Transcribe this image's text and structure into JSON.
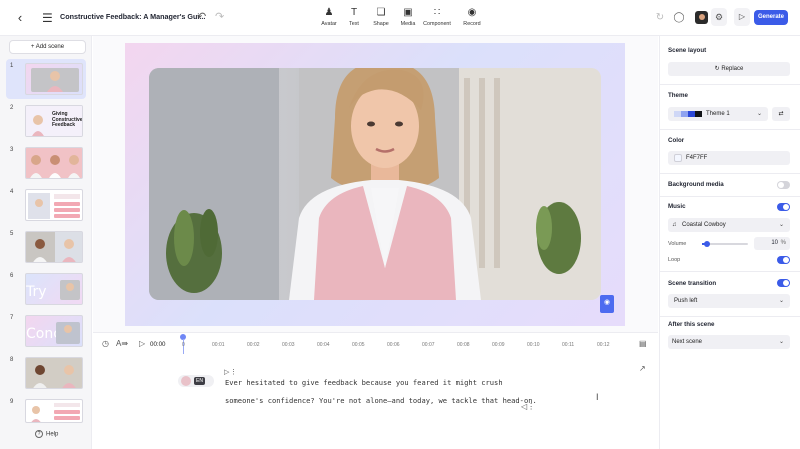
{
  "header": {
    "title": "Constructive Feedback: A Manager's Gui...",
    "tools": [
      "Avatar",
      "Text",
      "Shape",
      "Media",
      "Component",
      "Record"
    ],
    "generate_label": "Generate"
  },
  "sidebar": {
    "add_scene_label": "Add scene",
    "scenes": [
      "1",
      "2",
      "3",
      "4",
      "5",
      "6",
      "7",
      "8",
      "9"
    ],
    "scene2_thumb_text": "Giving Constructive Feedback",
    "help_label": "Help"
  },
  "timeline": {
    "current_time": "00:00",
    "ticks": [
      "0",
      "00:01",
      "00:02",
      "00:03",
      "00:04",
      "00:05",
      "00:06",
      "00:07",
      "00:08",
      "00:09",
      "00:10",
      "00:11",
      "00:12"
    ]
  },
  "script": {
    "language": "EN",
    "line1": "Ever hesitated to give feedback because you feared it might crush",
    "line2": "someone's confidence? You're not alone—and today, we tackle that head-on."
  },
  "right_panel": {
    "scene_layout_label": "Scene layout",
    "replace_label": "Replace",
    "theme_label": "Theme",
    "theme_value": "Theme 1",
    "theme_swatches": [
      "#cfd7f6",
      "#8fa3f0",
      "#2b48d8",
      "#111418"
    ],
    "color_label": "Color",
    "color_value": "F4F7FF",
    "background_media_label": "Background media",
    "music_label": "Music",
    "music_track": "Coastal Cowboy",
    "volume_label": "Volume",
    "volume_value": "10",
    "volume_unit": "%",
    "volume_fraction": 0.1,
    "loop_label": "Loop",
    "scene_transition_label": "Scene transition",
    "transition_value": "Push left",
    "after_scene_label": "After this scene",
    "after_scene_value": "Next scene"
  },
  "colors": {
    "accent": "#3b5be8",
    "selected_scene": "#dfe4fb",
    "vest": "#eab6be"
  }
}
